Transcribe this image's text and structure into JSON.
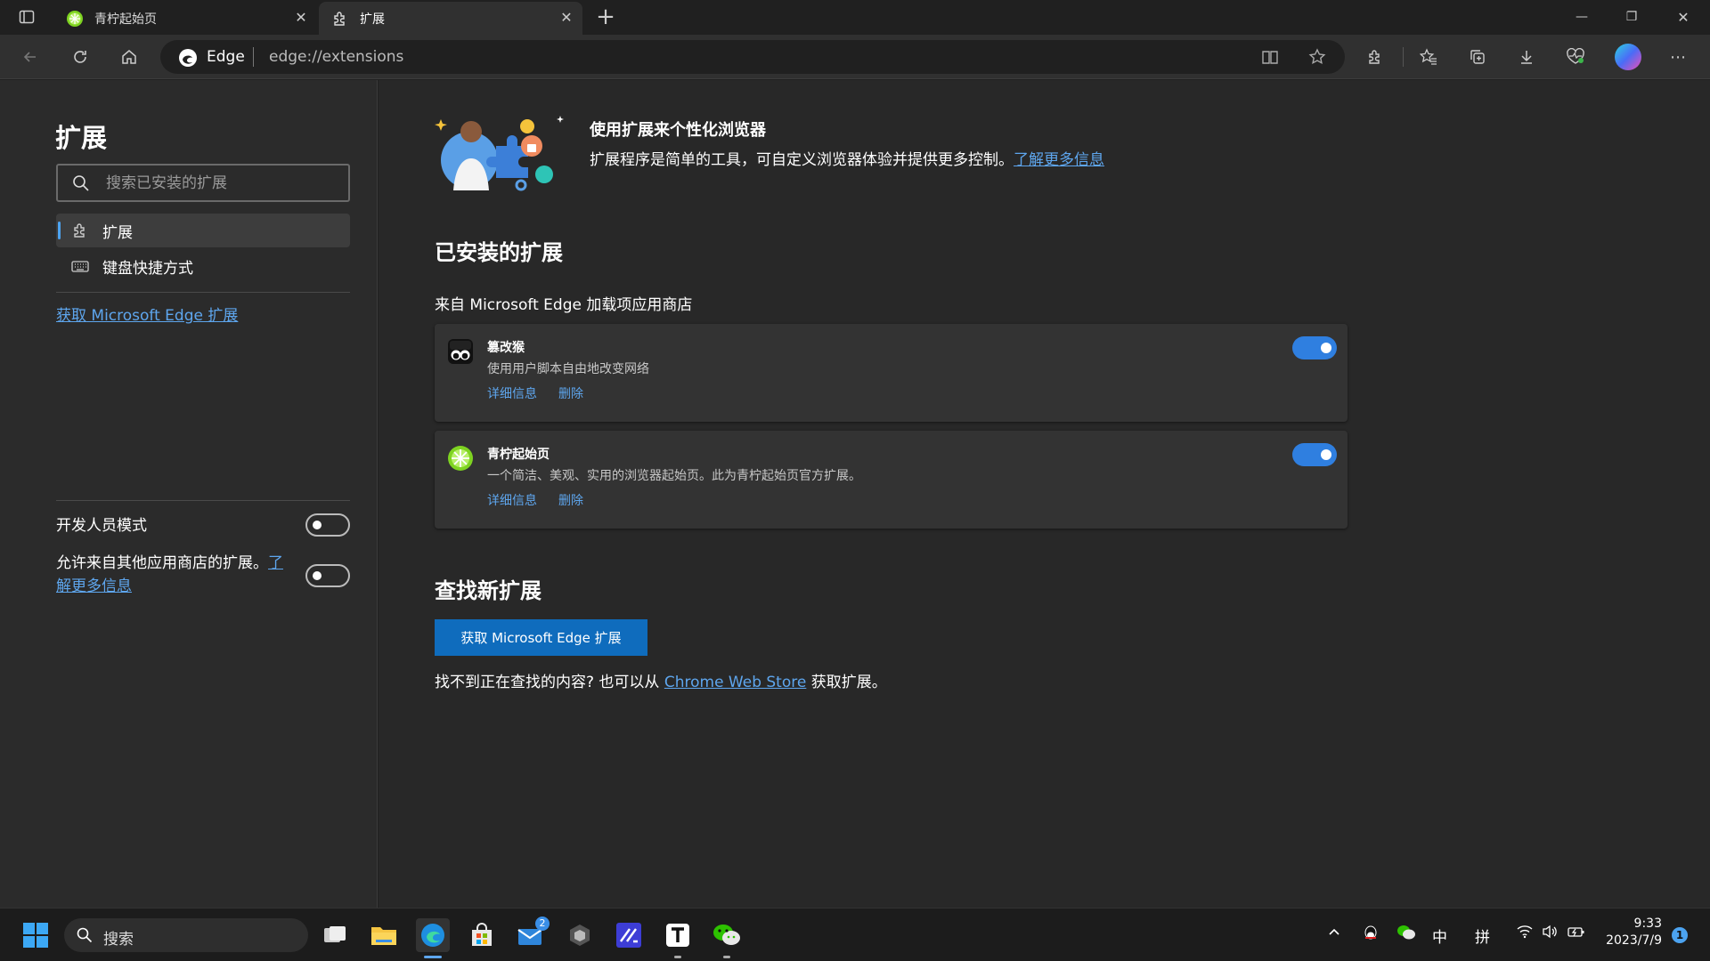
{
  "tabs": [
    {
      "label": "青柠起始页",
      "close": "✕"
    },
    {
      "label": "扩展",
      "close": "✕"
    }
  ],
  "new_tab": "+",
  "window_controls": {
    "minimize": "—",
    "restore": "❐",
    "close": "✕"
  },
  "address": {
    "brand": "Edge",
    "url": "edge://extensions"
  },
  "sidebar": {
    "title": "扩展",
    "search_placeholder": "搜索已安装的扩展",
    "items": [
      {
        "label": "扩展",
        "icon": "puzzle-icon",
        "active": true
      },
      {
        "label": "键盘快捷方式",
        "icon": "keyboard-icon",
        "active": false
      }
    ],
    "get_link": "获取 Microsoft Edge 扩展",
    "dev_mode_label": "开发人员模式",
    "dev_mode_on": false,
    "allow_other_label": "允许来自其他应用商店的扩展。",
    "allow_other_link_1": "了",
    "allow_other_link_2": "解更多信息",
    "allow_other_on": false
  },
  "hero": {
    "title": "使用扩展来个性化浏览器",
    "desc": "扩展程序是简单的工具，可自定义浏览器体验并提供更多控制。",
    "link": "了解更多信息"
  },
  "installed": {
    "heading": "已安装的扩展",
    "source": "来自 Microsoft Edge 加载项应用商店",
    "extensions": [
      {
        "name": "篡改猴",
        "desc": "使用用户脚本自由地改变网络",
        "details": "详细信息",
        "remove": "删除",
        "enabled": true,
        "icon": "tampermonkey-icon"
      },
      {
        "name": "青柠起始页",
        "desc": "一个简洁、美观、实用的浏览器起始页。此为青柠起始页官方扩展。",
        "details": "详细信息",
        "remove": "删除",
        "enabled": true,
        "icon": "lime-icon"
      }
    ]
  },
  "find": {
    "heading": "查找新扩展",
    "button": "获取 Microsoft Edge 扩展",
    "text_before": "找不到正在查找的内容? 也可以从",
    "link": "Chrome Web Store",
    "text_after": "获取扩展。"
  },
  "taskbar": {
    "search_placeholder": "搜索",
    "mail_badge": "2",
    "ime_1": "中",
    "ime_2": "拼",
    "time": "9:33",
    "date": "2023/7/9",
    "notification_count": "1"
  },
  "colors": {
    "accent": "#2f7fe0",
    "link": "#5ea6ee",
    "button": "#0f6cbd"
  }
}
